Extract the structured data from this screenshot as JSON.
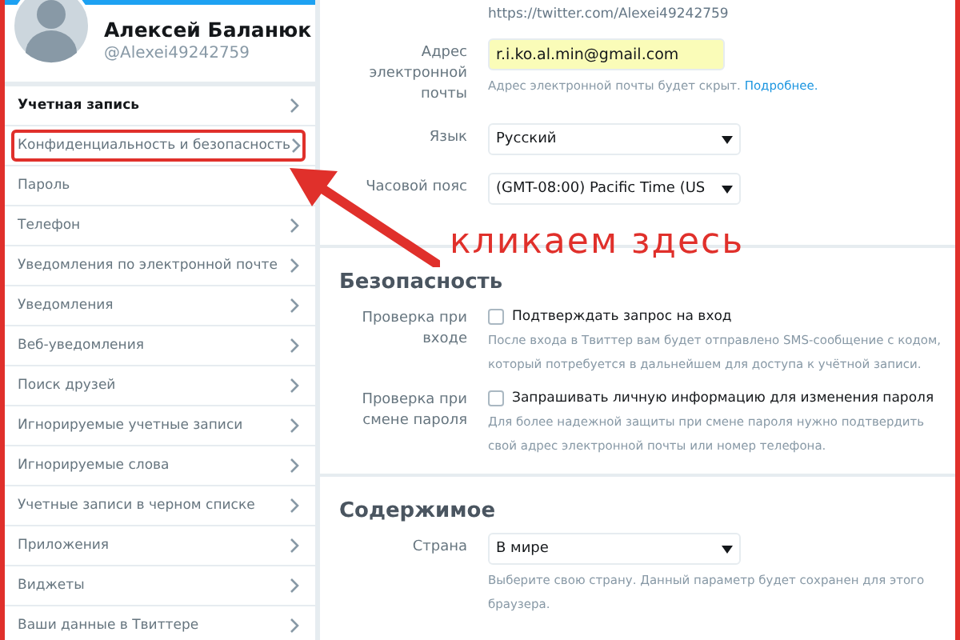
{
  "profile": {
    "name": "Алексей Баланюк",
    "handle": "@Alexei49242759"
  },
  "sidebar": {
    "items": [
      {
        "label": "Учетная запись",
        "selected": true,
        "chevron": true,
        "annotated": false
      },
      {
        "label": "Конфиденциальность и безопасность",
        "selected": false,
        "chevron": true,
        "annotated": true
      },
      {
        "label": "Пароль",
        "selected": false,
        "chevron": false,
        "annotated": false
      },
      {
        "label": "Телефон",
        "selected": false,
        "chevron": true,
        "annotated": false
      },
      {
        "label": "Уведомления по электронной почте",
        "selected": false,
        "chevron": true,
        "annotated": false
      },
      {
        "label": "Уведомления",
        "selected": false,
        "chevron": true,
        "annotated": false
      },
      {
        "label": "Веб-уведомления",
        "selected": false,
        "chevron": true,
        "annotated": false
      },
      {
        "label": "Поиск друзей",
        "selected": false,
        "chevron": true,
        "annotated": false
      },
      {
        "label": "Игнорируемые учетные записи",
        "selected": false,
        "chevron": true,
        "annotated": false
      },
      {
        "label": "Игнорируемые слова",
        "selected": false,
        "chevron": true,
        "annotated": false
      },
      {
        "label": "Учетные записи в черном списке",
        "selected": false,
        "chevron": true,
        "annotated": false
      },
      {
        "label": "Приложения",
        "selected": false,
        "chevron": true,
        "annotated": false
      },
      {
        "label": "Виджеты",
        "selected": false,
        "chevron": true,
        "annotated": false
      },
      {
        "label": "Ваши данные в Твиттере",
        "selected": false,
        "chevron": true,
        "annotated": false
      }
    ]
  },
  "account": {
    "url": "https://twitter.com/Alexei49242759",
    "rows": [
      {
        "kind": "input",
        "label": "Адрес электронной почты",
        "value": "r.i.ko.al.min@gmail.com",
        "hint": "Адрес электронной почты будет скрыт.",
        "link": "Подробнее."
      },
      {
        "kind": "select",
        "label": "Язык",
        "value": "Русский"
      },
      {
        "kind": "select",
        "label": "Часовой пояс",
        "value": "(GMT-08:00) Pacific Time (US"
      }
    ]
  },
  "sections": [
    {
      "title": "Безопасность",
      "rows": [
        {
          "kind": "checkbox",
          "label": "Проверка при входе",
          "option": "Подтверждать запрос на вход",
          "checked": false,
          "hint": "После входа в Твиттер вам будет отправлено SMS-сообщение с кодом, который потребуется в дальнейшем для доступа к учётной записи."
        },
        {
          "kind": "checkbox",
          "label": "Проверка при смене пароля",
          "option": "Запрашивать личную информацию для изменения пароля",
          "checked": false,
          "hint": "Для более надежной защиты при смене пароля нужно подтвердить свой адрес электронной почты или номер телефона."
        }
      ]
    },
    {
      "title": "Содержимое",
      "rows": [
        {
          "kind": "select",
          "label": "Страна",
          "value": "В мире",
          "hint": "Выберите свою страну. Данный параметр будет сохранен для этого браузера."
        }
      ]
    }
  ],
  "annotation": {
    "caption": "кликаем здесь"
  }
}
